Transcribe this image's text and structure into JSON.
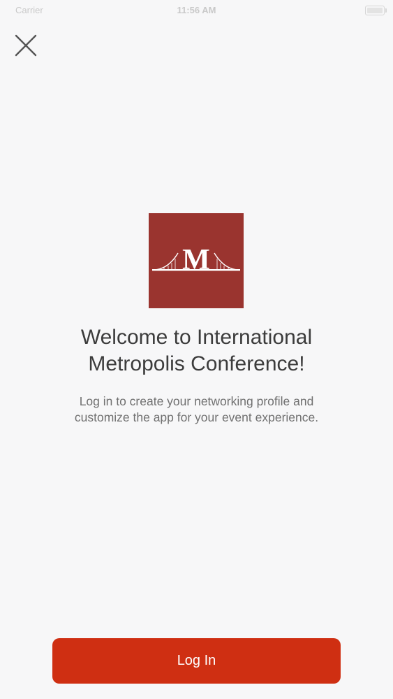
{
  "status_bar": {
    "carrier": "Carrier",
    "time": "11:56 AM"
  },
  "logo": {
    "letter": "M",
    "background_color": "#9a342f"
  },
  "welcome": {
    "title_line1": "Welcome to International",
    "title_line2": "Metropolis Conference!",
    "subtitle_line1": "Log in to create your networking profile and",
    "subtitle_line2": "customize the app for your event experience."
  },
  "actions": {
    "login_label": "Log In",
    "login_color": "#cf2f12"
  },
  "icons": {
    "close": "close-icon",
    "battery": "battery-icon",
    "wifi": "wifi-icon"
  }
}
